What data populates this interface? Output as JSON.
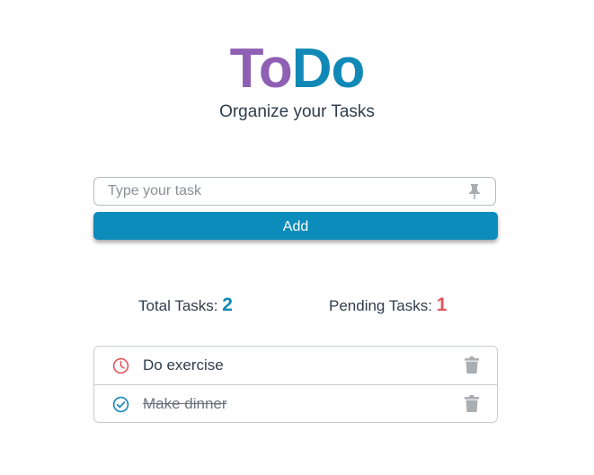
{
  "header": {
    "logo_part1": "To",
    "logo_part2": "Do",
    "subtitle": "Organize your Tasks"
  },
  "form": {
    "input_value": "",
    "input_placeholder": "Type your task",
    "add_label": "Add"
  },
  "stats": {
    "total_label": "Total Tasks:",
    "total_value": "2",
    "pending_label": "Pending Tasks:",
    "pending_value": "1"
  },
  "tasks": [
    {
      "text": "Do exercise",
      "status": "pending",
      "status_icon": "clock-icon",
      "action_icon": "trash-icon"
    },
    {
      "text": "Make dinner",
      "status": "done",
      "status_icon": "check-circle-icon",
      "action_icon": "trash-icon"
    }
  ],
  "colors": {
    "logo_to": "#8e5fb3",
    "logo_do": "#1189b6",
    "accent": "#0b8cbb",
    "pending": "#e0565c",
    "icon_gray": "#a9aeb3"
  }
}
